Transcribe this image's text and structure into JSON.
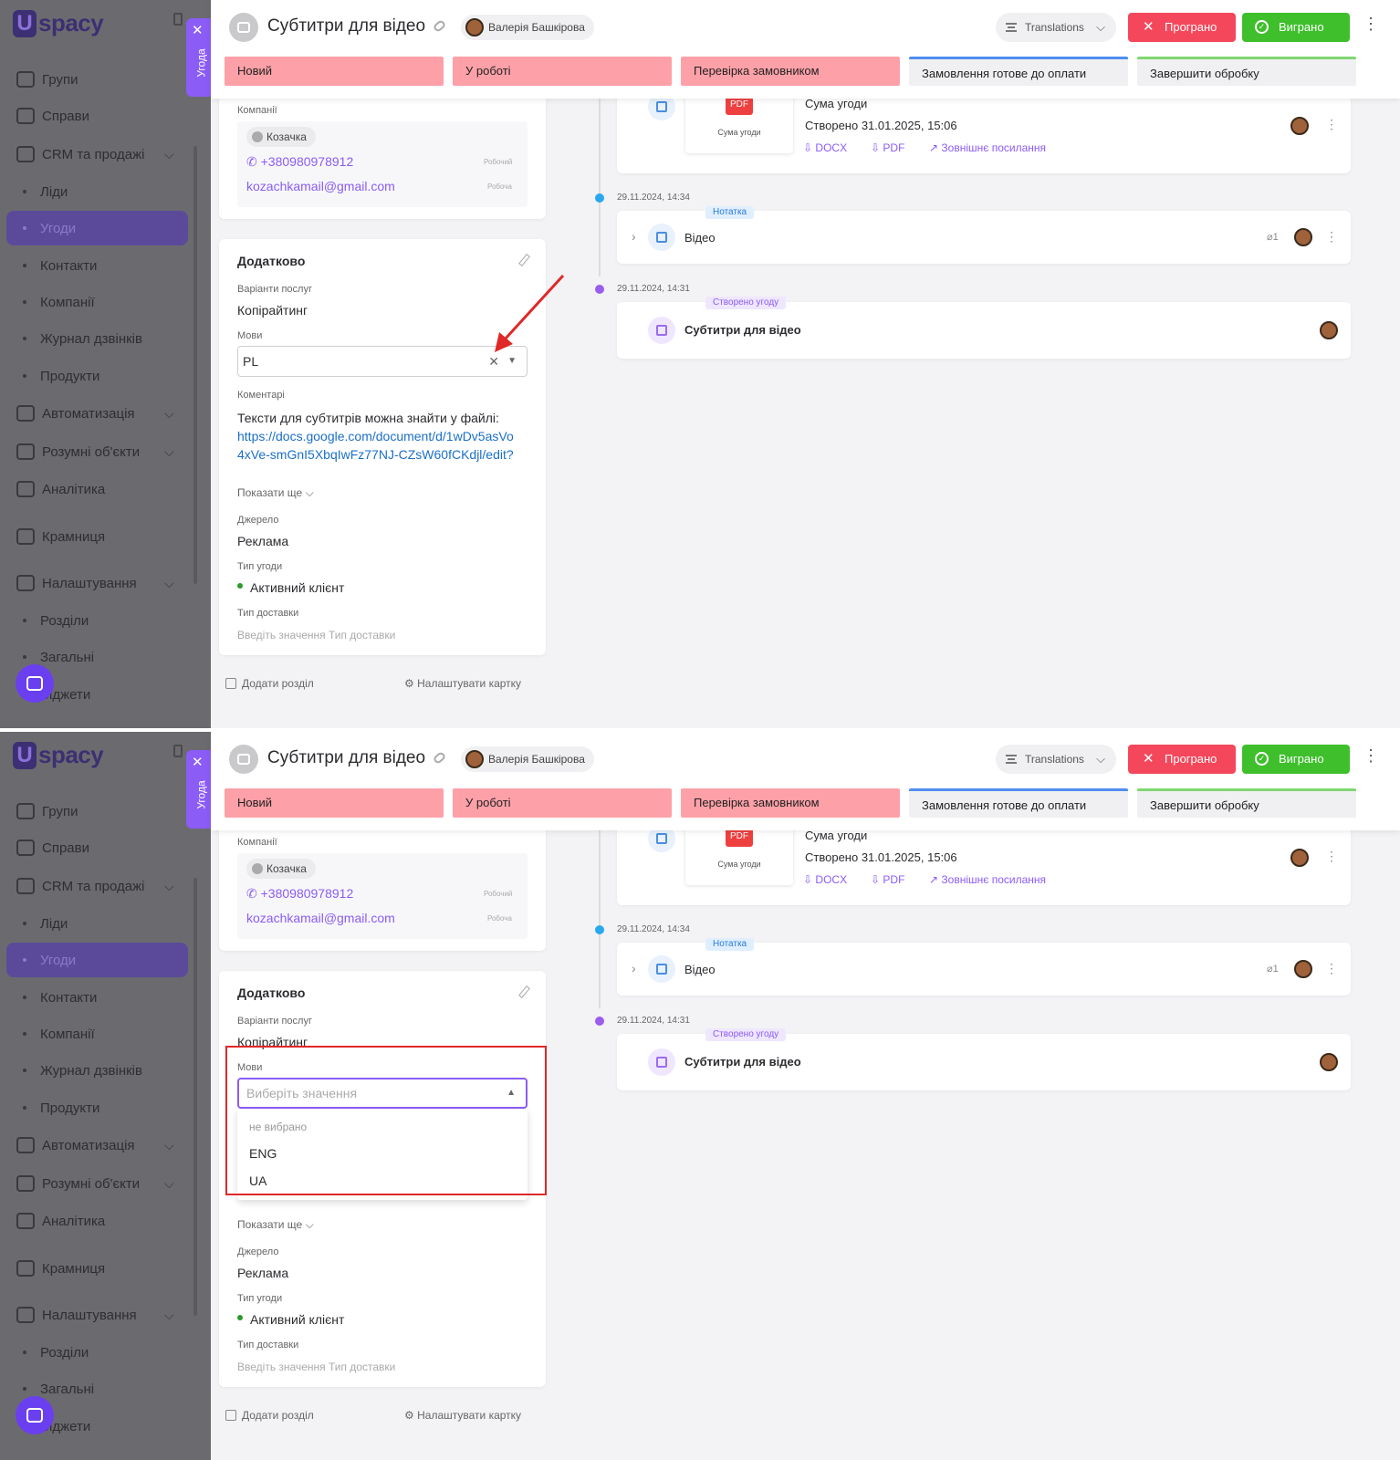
{
  "sidebar": {
    "logo": "spacy",
    "logo_letter": "U",
    "items": [
      {
        "label": "Групи",
        "icon": "users-icon",
        "sub": false,
        "chevron": false,
        "active": false
      },
      {
        "label": "Справи",
        "icon": "calendar-icon",
        "sub": false,
        "chevron": false,
        "active": false
      },
      {
        "label": "CRM та продажі",
        "icon": "funnel-icon",
        "sub": false,
        "chevron": true,
        "active": false
      },
      {
        "label": "Ліди",
        "sub": true,
        "active": false
      },
      {
        "label": "Угоди",
        "sub": true,
        "active": true
      },
      {
        "label": "Контакти",
        "sub": true,
        "active": false
      },
      {
        "label": "Компанії",
        "sub": true,
        "active": false
      },
      {
        "label": "Журнал дзвінків",
        "sub": true,
        "active": false
      },
      {
        "label": "Продукти",
        "sub": true,
        "active": false
      },
      {
        "label": "Автоматизація",
        "icon": "lightning-icon",
        "sub": false,
        "chevron": true,
        "active": false
      },
      {
        "label": "Розумні об'єкти",
        "icon": "smart-object-icon",
        "sub": false,
        "chevron": true,
        "active": false
      },
      {
        "label": "Аналітика",
        "icon": "chart-icon",
        "sub": false,
        "chevron": false,
        "active": false
      },
      {
        "label": "Крамниця",
        "icon": "store-icon",
        "sub": false,
        "chevron": false,
        "active": false
      },
      {
        "label": "Налаштування",
        "icon": "gear-icon",
        "sub": false,
        "chevron": true,
        "active": false
      },
      {
        "label": "Розділи",
        "sub": true,
        "active": false
      },
      {
        "label": "Загальні",
        "sub": true,
        "active": false
      },
      {
        "label": "Віджети",
        "sub": true,
        "active": false
      }
    ]
  },
  "side_tab": {
    "label": "Угода",
    "close": "✕"
  },
  "header": {
    "title": "Субтитри для відео",
    "owner": "Валерія Башкірова",
    "pipeline": "Translations",
    "lost_label": "Програно",
    "won_label": "Виграно",
    "stages": [
      "Новий",
      "У роботі",
      "Перевірка замовником",
      "Замовлення готове до оплати",
      "Завершити обробку"
    ]
  },
  "company_card": {
    "label": "Компанії",
    "company": "Козачка",
    "phone": "+380980978912",
    "phone_tag": "Робочий",
    "email": "kozachkamail@gmail.com",
    "email_tag": "Робоча"
  },
  "extra": {
    "title": "Додатково",
    "services_label": "Варіанти послуг",
    "services_value": "Копірайтинг",
    "languages_label": "Мови",
    "languages_value": "PL",
    "languages_placeholder": "Виберіть значення",
    "language_options": [
      "не вибрано",
      "ENG",
      "UA"
    ],
    "comments_label": "Коментарі",
    "comment_text": "Тексти для субтитрів можна знайти у файлі:",
    "comment_link": "https://docs.google.com/document/d/1wDv5asVo4xVe-smGnI5XbqIwFz77NJ-CZsW60fCKdjl/edit?",
    "comment_link_partial": "CZsW60fCKdjl/edit?",
    "show_more": "Показати ще",
    "source_label": "Джерело",
    "source_value": "Реклама",
    "deal_type_label": "Тип угоди",
    "deal_type_value": "Активний клієнт",
    "delivery_label": "Тип доставки",
    "delivery_placeholder": "Введіть значення Тип доставки"
  },
  "footer": {
    "add_section": "Додати розділ",
    "configure_card": "Налаштувати картку"
  },
  "timeline": {
    "document": {
      "title": "Сума угоди",
      "created": "Створено 31.01.2025, 15:06",
      "thumb_badge": "PDF",
      "thumb_caption": "Сума угоди",
      "docx": "DOCX",
      "pdf": "PDF",
      "external": "Зовнішнє посилання"
    },
    "note": {
      "date": "29.11.2024, 14:34",
      "badge": "Нотатка",
      "title": "Відео",
      "attachments": "1"
    },
    "created": {
      "date": "29.11.2024, 14:31",
      "badge": "Створено угоду",
      "title": "Субтитри для відео"
    }
  },
  "colors": {
    "accent": "#8b5cf6",
    "lost": "#f5475b",
    "won": "#3fbf2c",
    "stage_done": "#fda0a8",
    "annotation": "#e02828"
  }
}
